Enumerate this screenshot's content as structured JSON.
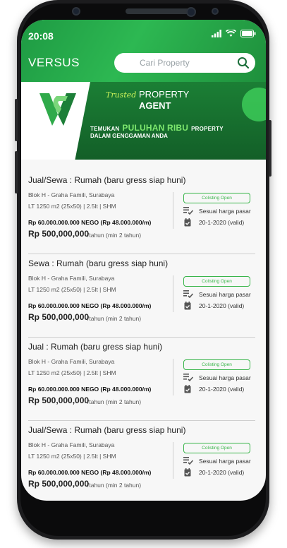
{
  "status": {
    "time": "20:08"
  },
  "header": {
    "title": "VERSUS",
    "search_placeholder": "Cari Property"
  },
  "banner": {
    "trusted": "Trusted",
    "property": "PROPERTY",
    "agent": "AGENT",
    "line1_pre": "TEMUKAN",
    "line1_highlight": "PULUHAN RIBU",
    "line1_post": "PROPERTY",
    "line2": "DALAM GENGGAMAN ANDA"
  },
  "listings": [
    {
      "title": "Jual/Sewa : Rumah (baru gress siap huni)",
      "address": "Blok H - Graha Famili, Surabaya",
      "spec": "LT 1250 m2 (25x50) | 2.5lt | SHM",
      "nego": "Rp 60.000.000.000 NEGO (Rp 48.000.000/m)",
      "price": "Rp 500,000,000",
      "period": "/tahun (min 2 tahun)",
      "badge": "Colisting Open",
      "note1": "Sesuai harga pasar",
      "note2": "20-1-2020 (valid)"
    },
    {
      "title": "Sewa : Rumah (baru gress siap huni)",
      "address": "Blok H - Graha Famili, Surabaya",
      "spec": "LT 1250 m2 (25x50) | 2.5lt | SHM",
      "nego": "Rp 60.000.000.000 NEGO (Rp 48.000.000/m)",
      "price": "Rp 500,000,000",
      "period": "/tahun (min 2 tahun)",
      "badge": "Colisting Open",
      "note1": "Sesuai harga pasar",
      "note2": "20-1-2020 (valid)"
    },
    {
      "title": "Jual : Rumah (baru gress siap huni)",
      "address": "Blok H - Graha Famili, Surabaya",
      "spec": "LT 1250 m2 (25x50) | 2.5lt | SHM",
      "nego": "Rp 60.000.000.000 NEGO (Rp 48.000.000/m)",
      "price": "Rp 500,000,000",
      "period": "/tahun (min 2 tahun)",
      "badge": "Colisting Open",
      "note1": "Sesuai harga pasar",
      "note2": "20-1-2020 (valid)"
    },
    {
      "title": "Jual/Sewa : Rumah (baru gress siap huni)",
      "address": "Blok H - Graha Famili, Surabaya",
      "spec": "LT 1250 m2 (25x50) | 2.5lt | SHM",
      "nego": "Rp 60.000.000.000 NEGO (Rp 48.000.000/m)",
      "price": "Rp 500,000,000",
      "period": "/tahun (min 2 tahun)",
      "badge": "Colisting Open",
      "note1": "Sesuai harga pasar",
      "note2": "20-1-2020 (valid)"
    }
  ]
}
